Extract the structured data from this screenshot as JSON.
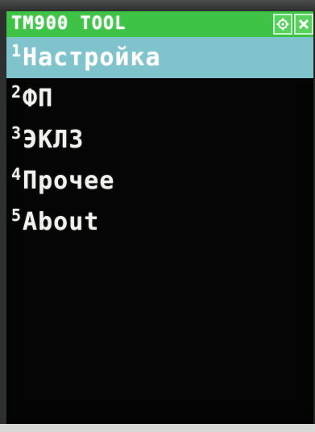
{
  "window": {
    "title": "TM900 TOOL",
    "buttons": [
      {
        "name": "settings",
        "icon": "gear-icon"
      },
      {
        "name": "close",
        "icon": "close-icon"
      }
    ]
  },
  "menu": {
    "items": [
      {
        "number": "1",
        "label": "Настройка",
        "selected": true
      },
      {
        "number": "2",
        "label": "ФП",
        "selected": false
      },
      {
        "number": "3",
        "label": "ЭКЛЗ",
        "selected": false
      },
      {
        "number": "4",
        "label": "Прочее",
        "selected": false
      },
      {
        "number": "5",
        "label": "About",
        "selected": false
      }
    ]
  },
  "colors": {
    "titlebar": "#3fc347",
    "selection": "#7fc3cc",
    "screen": "#040504",
    "text": "#f1f1ee"
  }
}
